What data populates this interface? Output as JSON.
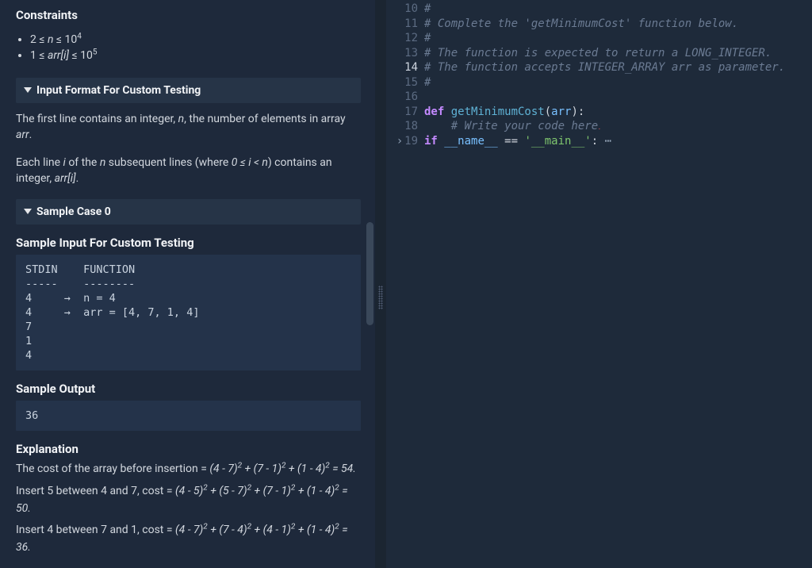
{
  "constraints": {
    "heading": "Constraints",
    "items_html": [
      "2 ≤ <span class='it'>n</span> ≤ 10<sup>4</sup>",
      "1 ≤ <span class='it'>arr[i]</span> ≤ 10<sup>5</sup>"
    ]
  },
  "input_format": {
    "heading": "Input Format For Custom Testing",
    "para1_html": "The first line contains an integer, <span class='it'>n</span>, the number of elements in array <span class='it'>arr</span>.",
    "para2_html": "Each line <span class='it'>i</span> of the <span class='it'>n</span> subsequent lines (where <span class='it'>0 ≤ i &lt; n</span>) contains an integer, <span class='it'>arr[i]</span>."
  },
  "sample": {
    "heading": "Sample Case 0",
    "input_label": "Sample Input For Custom Testing",
    "input_text": "STDIN    FUNCTION\n-----    --------\n4     →  n = 4\n4     →  arr = [4, 7, 1, 4]\n7\n1\n4",
    "output_label": "Sample Output",
    "output_text": "36",
    "explanation_label": "Explanation",
    "expl1_html": "The cost of the array before insertion = <span class='it'>(4 - 7)<sup>2</sup> + (7 - 1)<sup>2</sup> + (1 - 4)<sup>2</sup> = 54.</span>",
    "expl2_html": "Insert 5 between 4 and 7, cost = <span class='it'>(4 - 5)<sup>2</sup> + (5 - 7)<sup>2</sup> + (7 - 1)<sup>2</sup> + (1 - 4)<sup>2</sup> = 50.</span>",
    "expl3_html": "Insert 4 between 7 and 1, cost = <span class='it'>(4 - 7)<sup>2</sup> + (7 - 4)<sup>2</sup> + (4 - 1)<sup>2</sup> + (1 - 4)<sup>2</sup> = 36.</span>"
  },
  "editor": {
    "lines": [
      {
        "n": 10,
        "seg": [
          {
            "c": "cmt",
            "t": "#"
          }
        ]
      },
      {
        "n": 11,
        "seg": [
          {
            "c": "cmt",
            "t": "# Complete the 'getMinimumCost' function below."
          }
        ]
      },
      {
        "n": 12,
        "seg": [
          {
            "c": "cmt",
            "t": "#"
          }
        ]
      },
      {
        "n": 13,
        "seg": [
          {
            "c": "cmt",
            "t": "# The function is expected to return a LONG_INTEGER."
          }
        ]
      },
      {
        "n": 14,
        "hl": true,
        "seg": [
          {
            "c": "cmt",
            "t": "# The function accepts INTEGER_ARRAY arr as parameter."
          }
        ]
      },
      {
        "n": 15,
        "seg": [
          {
            "c": "cmt",
            "t": "#"
          }
        ]
      },
      {
        "n": 16,
        "seg": [
          {
            "c": "",
            "t": ""
          }
        ]
      },
      {
        "n": 17,
        "seg": [
          {
            "c": "kw",
            "t": "def "
          },
          {
            "c": "fn",
            "t": "getMinimumCost"
          },
          {
            "c": "op",
            "t": "("
          },
          {
            "c": "pr",
            "t": "arr"
          },
          {
            "c": "op",
            "t": "):"
          }
        ]
      },
      {
        "n": 18,
        "indent": "    ",
        "seg": [
          {
            "c": "cmt",
            "t": "# Write your code here"
          }
        ],
        "caret": true
      },
      {
        "n": 19,
        "fold": true,
        "seg": [
          {
            "c": "kw",
            "t": "if "
          },
          {
            "c": "pr",
            "t": "__name__"
          },
          {
            "c": "op",
            "t": " == "
          },
          {
            "c": "str",
            "t": "'__main__'"
          },
          {
            "c": "op",
            "t": ":"
          },
          {
            "c": "fold",
            "t": " ⋯"
          }
        ]
      }
    ]
  }
}
